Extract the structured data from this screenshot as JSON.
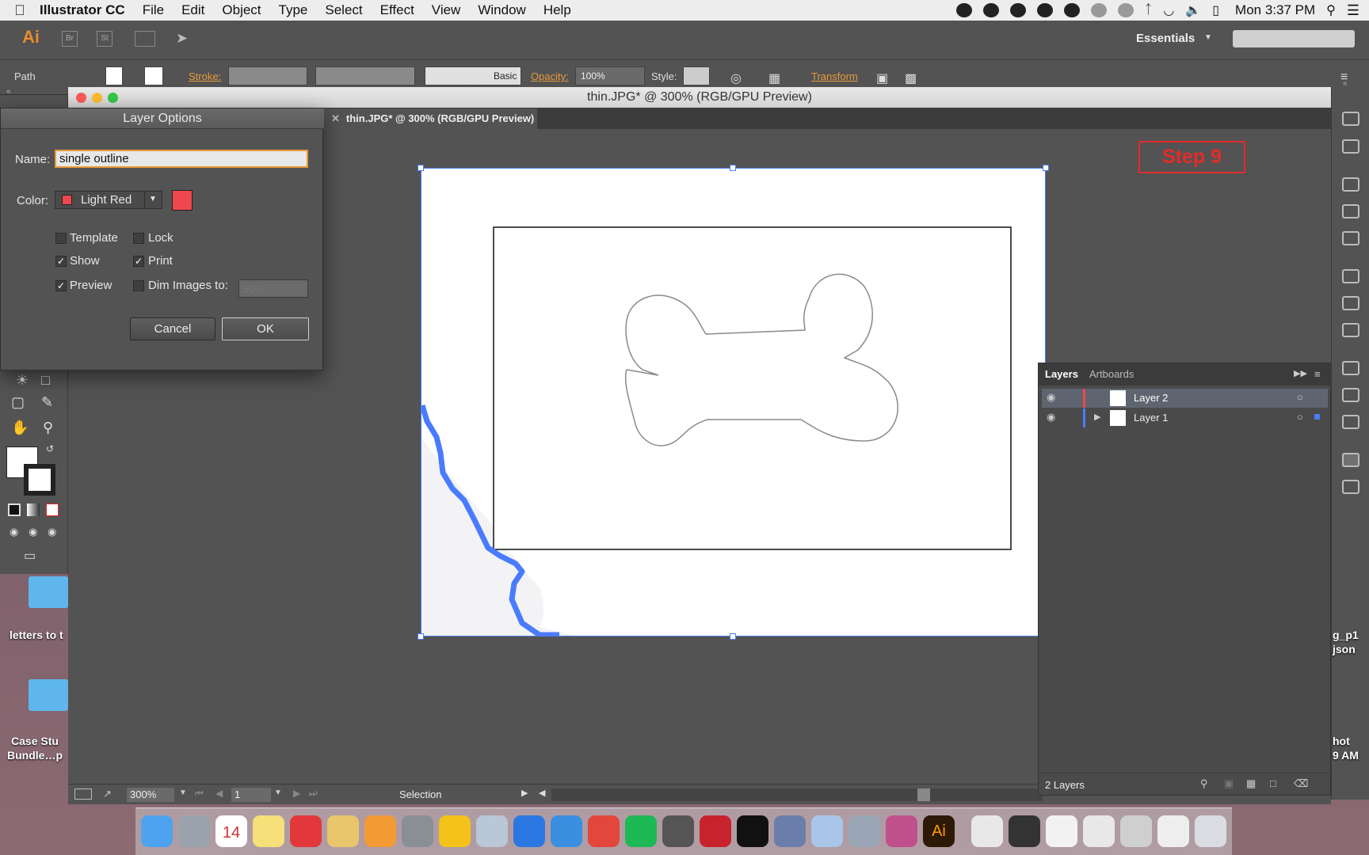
{
  "menubar": {
    "app_name": "Illustrator CC",
    "items": [
      "File",
      "Edit",
      "Object",
      "Type",
      "Select",
      "Effect",
      "View",
      "Window",
      "Help"
    ],
    "clock": "Mon 3:37 PM"
  },
  "appbar": {
    "logo": "Ai",
    "br": "Br",
    "st": "St",
    "workspace": "Essentials"
  },
  "control": {
    "object_type": "Path",
    "stroke_label": "Stroke:",
    "brush_label": "Basic",
    "opacity_label": "Opacity:",
    "opacity_value": "100%",
    "style_label": "Style:",
    "transform_label": "Transform"
  },
  "document": {
    "window_title": "thin.JPG* @ 300% (RGB/GPU Preview)",
    "tab_label": "thin.JPG* @ 300% (RGB/GPU Preview)",
    "step_badge": "Step 9"
  },
  "status": {
    "zoom": "300%",
    "page": "1",
    "tool": "Selection"
  },
  "dialog": {
    "title": "Layer Options",
    "name_label": "Name:",
    "name_value": "single outline",
    "color_label": "Color:",
    "color_value": "Light Red",
    "color_hex": "#f0474f",
    "template_label": "Template",
    "lock_label": "Lock",
    "show_label": "Show",
    "print_label": "Print",
    "preview_label": "Preview",
    "dim_label": "Dim Images to:",
    "dim_placeholder": "50%",
    "cancel_label": "Cancel",
    "ok_label": "OK",
    "checks": {
      "template": false,
      "lock": false,
      "show": true,
      "print": true,
      "preview": true,
      "dim": false
    }
  },
  "layers_panel": {
    "tab_layers": "Layers",
    "tab_artboards": "Artboards",
    "rows": [
      {
        "name": "Layer 2",
        "color": "#f0474f",
        "selected": true
      },
      {
        "name": "Layer 1",
        "color": "#4a7bff",
        "selected": false
      }
    ],
    "count": "2 Layers"
  },
  "desktop": {
    "left_label_1": "letters to t",
    "left_label_2a": "Case Stu",
    "left_label_2b": "Bundle…p",
    "right_label_1a": "g_p1",
    "right_label_1b": "json",
    "right_label_2a": "hot",
    "right_label_2b": "9 AM"
  },
  "dock": {
    "calendar_day": "14"
  }
}
